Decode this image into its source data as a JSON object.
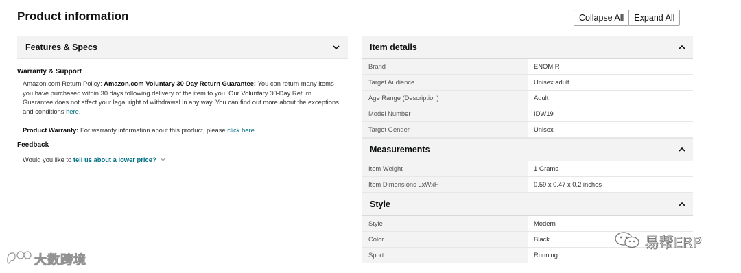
{
  "header": {
    "title": "Product information",
    "collapse_label": "Collapse All",
    "expand_label": "Expand All"
  },
  "features": {
    "title": "Features & Specs",
    "warranty_support_title": "Warranty & Support",
    "return_policy_prefix": "Amazon.com Return Policy:",
    "return_policy_bold": "Amazon.com Voluntary 30-Day Return Guarantee:",
    "return_policy_text": "You can return many items you have purchased within 30 days following delivery of the item to you. Our Voluntary 30-Day Return Guarantee does not affect your legal right of withdrawal in any way. You can find out more about the exceptions and conditions",
    "return_policy_link": "here",
    "return_policy_end": ".",
    "warranty_bold": "Product Warranty:",
    "warranty_text": "For warranty information about this product, please",
    "warranty_link": "click here",
    "feedback_title": "Feedback",
    "feedback_text": "Would you like to",
    "feedback_link": "tell us about a lower price?"
  },
  "item_details": {
    "title": "Item details",
    "rows": [
      {
        "key": "Brand",
        "value": "ENOMIR"
      },
      {
        "key": "Target Audience",
        "value": "Unisex adult"
      },
      {
        "key": "Age Range (Description)",
        "value": "Adult"
      },
      {
        "key": "Model Number",
        "value": "IDW19"
      },
      {
        "key": "Target Gender",
        "value": "Unisex"
      }
    ]
  },
  "measurements": {
    "title": "Measurements",
    "rows": [
      {
        "key": "Item Weight",
        "value": "1 Grams"
      },
      {
        "key": "Item Dimensions LxWxH",
        "value": "0.59 x 0.47 x 0.2 inches"
      }
    ]
  },
  "style": {
    "title": "Style",
    "rows": [
      {
        "key": "Style",
        "value": "Modern"
      },
      {
        "key": "Color",
        "value": "Black"
      },
      {
        "key": "Sport",
        "value": "Running"
      }
    ]
  },
  "watermarks": {
    "left_text": "大数跨境",
    "right_text": "易帮ERP"
  },
  "icons": {
    "chevron_down": "chevron-down-icon",
    "chevron_up": "chevron-up-icon",
    "watermark_left_logo": "chat-bubble-logo-icon",
    "watermark_right_logo": "wechat-logo-icon"
  },
  "colors": {
    "link": "#007185",
    "header_bg": "#f3f3f3",
    "border": "#e3e6e6"
  }
}
